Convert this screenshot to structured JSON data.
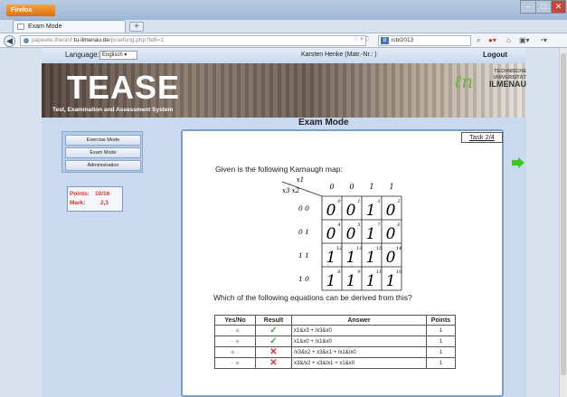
{
  "browser": {
    "menu_label": "Firefox",
    "tab_title": "Exam Mode",
    "new_tab": "+",
    "url_prefix": "papeete.theoinf.",
    "url_domain": "tu-ilmenau.de",
    "url_path": "/pruefung.php?left=1",
    "search_text": "icbl2013",
    "search_engine": "8"
  },
  "header": {
    "language_label": "Language:",
    "language_value": "Englisch",
    "user_text": "Karsten Henke   (Matr.-Nr.: )",
    "logout": "Logout",
    "logo_text": "TEASE",
    "logo_subtitle": "Test, Examination and Assessment System",
    "uni_line1": "TECHNISCHE",
    "uni_line2": "UNIVERSITÄT",
    "uni_line3": "ILMENAU"
  },
  "page_title": "Exam Mode",
  "menu": {
    "items": [
      "Exercise Mode",
      "Exam Mode",
      "Administration"
    ]
  },
  "score": {
    "points_label": "Points:",
    "points_value": "10/16",
    "mark_label": "Mark:",
    "mark_value": "2,3"
  },
  "task": {
    "counter": "Task 2/4",
    "prompt": "Given is the following Karnaugh map:",
    "question": "Which of the following equations can be derived from this?",
    "kmap": {
      "var_row": "x3 x2",
      "var_col": "x1",
      "col_headers": [
        "0",
        "0",
        "1",
        "1"
      ],
      "row_headers": [
        "0 0",
        "0 1",
        "1 1",
        "1 0"
      ],
      "cells": [
        [
          {
            "v": "0",
            "i": "0"
          },
          {
            "v": "0",
            "i": "1"
          },
          {
            "v": "1",
            "i": "3"
          },
          {
            "v": "0",
            "i": "2"
          }
        ],
        [
          {
            "v": "0",
            "i": "4"
          },
          {
            "v": "0",
            "i": "5"
          },
          {
            "v": "1",
            "i": "7"
          },
          {
            "v": "0",
            "i": "6"
          }
        ],
        [
          {
            "v": "1",
            "i": "12"
          },
          {
            "v": "1",
            "i": "13"
          },
          {
            "v": "1",
            "i": "15"
          },
          {
            "v": "0",
            "i": "14"
          }
        ],
        [
          {
            "v": "1",
            "i": "8"
          },
          {
            "v": "1",
            "i": "9"
          },
          {
            "v": "1",
            "i": "11"
          },
          {
            "v": "1",
            "i": "10"
          }
        ]
      ]
    },
    "table": {
      "headers": [
        "Yes/No",
        "Result",
        "Answer",
        "Points"
      ],
      "rows": [
        {
          "yes_no": "○ ◉",
          "result": "✓",
          "result_color": "#2fb52f",
          "answer": "x1&x3 + /x3&x0",
          "points": "1"
        },
        {
          "yes_no": "○ ◉",
          "result": "✓",
          "result_color": "#2fb52f",
          "answer": "x1&x0 + /x1&x0",
          "points": "1"
        },
        {
          "yes_no": "◉ ○",
          "result": "✕",
          "result_color": "#e8302f",
          "answer": "/x3&x2 + x3&x1 + /x1&/x0",
          "points": "1"
        },
        {
          "yes_no": "○ ◉",
          "result": "✕",
          "result_color": "#e8302f",
          "answer": "x3&/x2 + x3&/x1 + x1&x0",
          "points": "1"
        }
      ]
    }
  },
  "colors": {
    "arrow_green": "#3bc81f",
    "score_red": "#e8302f"
  }
}
